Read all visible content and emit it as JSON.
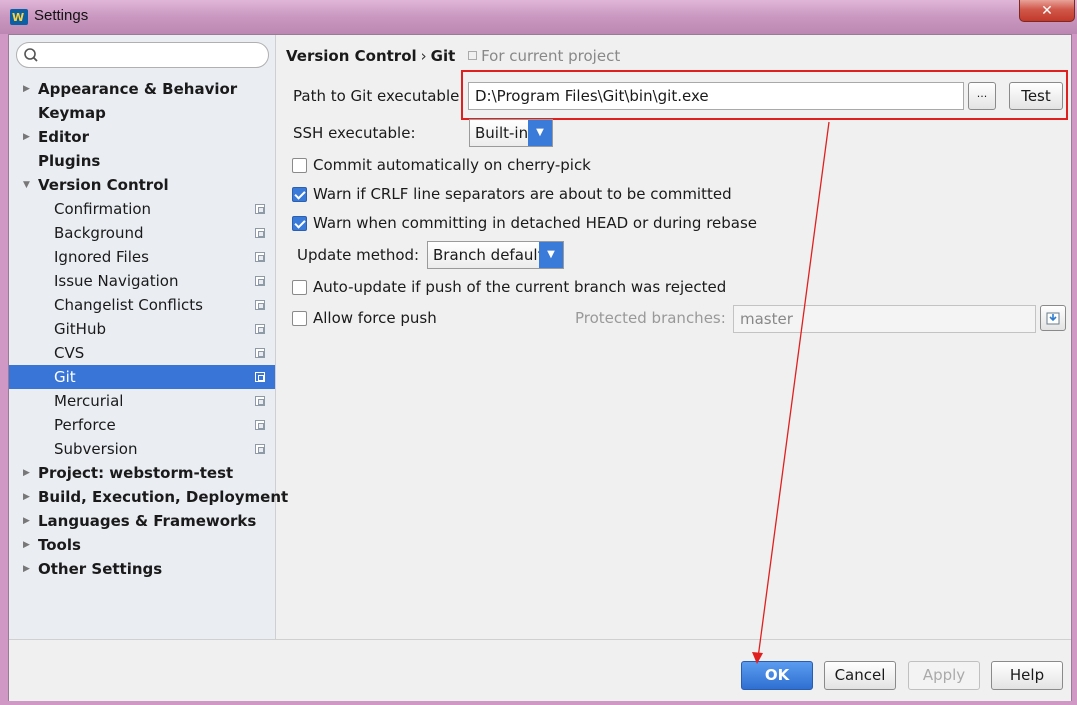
{
  "window": {
    "title": "Settings",
    "close_label": "✕"
  },
  "sidebar": {
    "search_placeholder": "",
    "items": [
      {
        "label": "Appearance & Behavior"
      },
      {
        "label": "Keymap"
      },
      {
        "label": "Editor"
      },
      {
        "label": "Plugins"
      },
      {
        "label": "Version Control"
      },
      {
        "label": "Confirmation"
      },
      {
        "label": "Background"
      },
      {
        "label": "Ignored Files"
      },
      {
        "label": "Issue Navigation"
      },
      {
        "label": "Changelist Conflicts"
      },
      {
        "label": "GitHub"
      },
      {
        "label": "CVS"
      },
      {
        "label": "Git"
      },
      {
        "label": "Mercurial"
      },
      {
        "label": "Perforce"
      },
      {
        "label": "Subversion"
      },
      {
        "label": "Project: webstorm-test"
      },
      {
        "label": "Build, Execution, Deployment"
      },
      {
        "label": "Languages & Frameworks"
      },
      {
        "label": "Tools"
      },
      {
        "label": "Other Settings"
      }
    ]
  },
  "breadcrumb": {
    "parent": "Version Control",
    "separator": "›",
    "current": "Git",
    "scope": "For current project"
  },
  "git": {
    "path_label": "Path to Git executable:",
    "path_value": "D:\\Program Files\\Git\\bin\\git.exe",
    "browse_label": "...",
    "test_label": "Test",
    "ssh_label": "SSH executable:",
    "ssh_value": "Built-in",
    "commit_auto_label": "Commit automatically on cherry-pick",
    "crlf_label": "Warn if CRLF line separators are about to be committed",
    "detached_label": "Warn when committing in detached HEAD or during rebase",
    "update_method_label": "Update method:",
    "update_method_value": "Branch default",
    "auto_update_label": "Auto-update if push of the current branch was rejected",
    "force_push_label": "Allow force push",
    "protected_label": "Protected branches:",
    "protected_value": "master"
  },
  "footer": {
    "ok": "OK",
    "cancel": "Cancel",
    "apply": "Apply",
    "help": "Help"
  },
  "colors": {
    "accent": "#3875d7",
    "annotation": "#e0201f"
  }
}
